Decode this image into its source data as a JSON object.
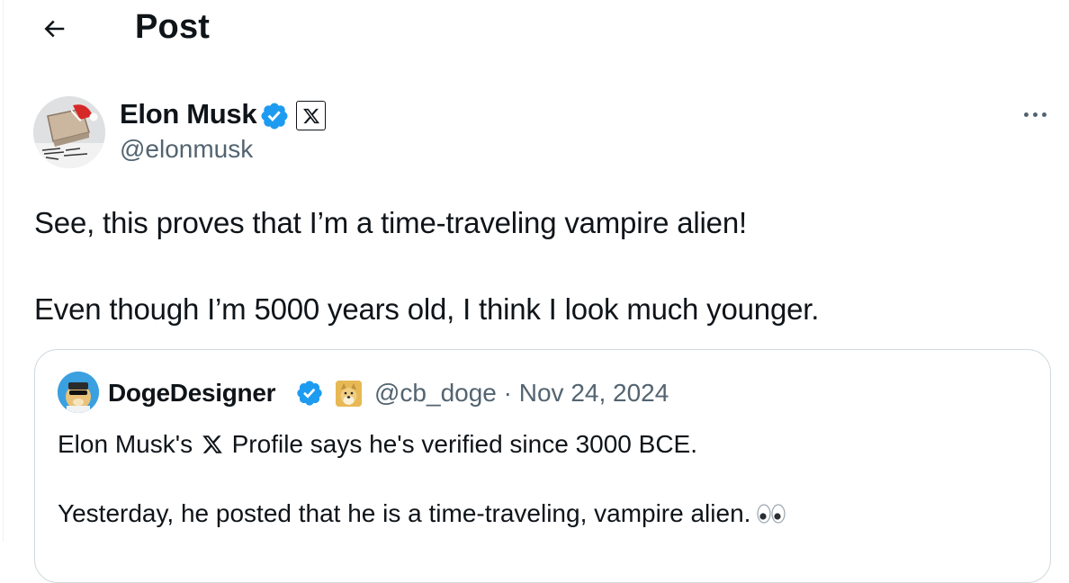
{
  "header": {
    "title": "Post"
  },
  "post": {
    "author": {
      "name": "Elon Musk",
      "handle": "@elonmusk"
    },
    "text_lines": [
      "See, this proves that I’m a time-traveling vampire alien!",
      "Even though I’m 5000 years old, I think I look much younger."
    ]
  },
  "quote": {
    "author": {
      "name": "DogeDesigner",
      "handle": "@cb_doge",
      "separator": "·",
      "date": "Nov 24, 2024"
    },
    "line1_before": "Elon Musk's",
    "line1_after": "Profile says he's verified since 3000 BCE.",
    "line2": "Yesterday, he posted that he is a time-traveling, vampire alien."
  },
  "colors": {
    "text": "#0f1419",
    "secondary": "#536471",
    "verified_blue": "#1d9bf0",
    "border": "#cfd9de"
  }
}
